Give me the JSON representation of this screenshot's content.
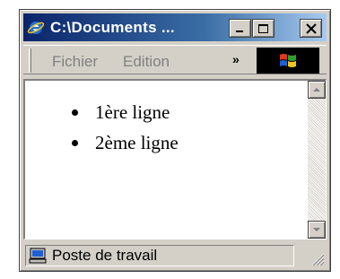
{
  "window": {
    "title": "C:\\Documents ...",
    "icon": "internet-explorer-icon"
  },
  "title_buttons": {
    "minimize_icon": "minimize-icon",
    "maximize_icon": "maximize-icon",
    "close_icon": "close-icon"
  },
  "menu": {
    "items": [
      {
        "label": "Fichier"
      },
      {
        "label": "Edition"
      }
    ],
    "overflow_label": "»",
    "throbber_icon": "windows-logo-icon"
  },
  "content": {
    "list": [
      {
        "text": "1ère ligne"
      },
      {
        "text": "2ème ligne"
      }
    ]
  },
  "statusbar": {
    "icon": "my-computer-icon",
    "text": "Poste de travail"
  },
  "colors": {
    "titlebar_start": "#0a246a",
    "titlebar_end": "#a6caf0",
    "chrome": "#d4d0c8"
  }
}
